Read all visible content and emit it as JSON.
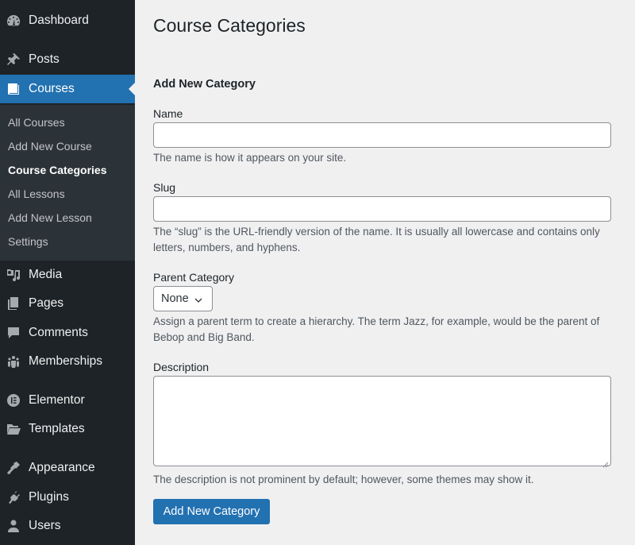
{
  "sidebar": {
    "items": [
      {
        "label": "Dashboard",
        "icon": "dashboard-icon"
      },
      {
        "label": "Posts",
        "icon": "pushpin-icon"
      },
      {
        "label": "Courses",
        "icon": "book-icon",
        "active": true
      },
      {
        "label": "Media",
        "icon": "media-icon"
      },
      {
        "label": "Pages",
        "icon": "pages-icon"
      },
      {
        "label": "Comments",
        "icon": "comment-icon"
      },
      {
        "label": "Memberships",
        "icon": "groups-icon"
      },
      {
        "label": "Elementor",
        "icon": "elementor-icon"
      },
      {
        "label": "Templates",
        "icon": "folder-icon"
      },
      {
        "label": "Appearance",
        "icon": "paintbrush-icon"
      },
      {
        "label": "Plugins",
        "icon": "plug-icon"
      },
      {
        "label": "Users",
        "icon": "user-icon"
      }
    ],
    "submenu": [
      {
        "label": "All Courses"
      },
      {
        "label": "Add New Course"
      },
      {
        "label": "Course Categories",
        "current": true
      },
      {
        "label": "All Lessons"
      },
      {
        "label": "Add New Lesson"
      },
      {
        "label": "Settings"
      }
    ]
  },
  "main": {
    "title": "Course Categories",
    "section_title": "Add New Category",
    "name": {
      "label": "Name",
      "value": "",
      "help": "The name is how it appears on your site."
    },
    "slug": {
      "label": "Slug",
      "value": "",
      "help": "The “slug” is the URL-friendly version of the name. It is usually all lowercase and contains only letters, numbers, and hyphens."
    },
    "parent": {
      "label": "Parent Category",
      "selected": "None",
      "help": "Assign a parent term to create a hierarchy. The term Jazz, for example, would be the parent of Bebop and Big Band."
    },
    "description": {
      "label": "Description",
      "value": "",
      "help": "The description is not prominent by default; however, some themes may show it."
    },
    "submit_label": "Add New Category"
  },
  "colors": {
    "sidebar_bg": "#1d2327",
    "submenu_bg": "#2c3338",
    "accent": "#2271b1",
    "page_bg": "#f0f0f1"
  }
}
